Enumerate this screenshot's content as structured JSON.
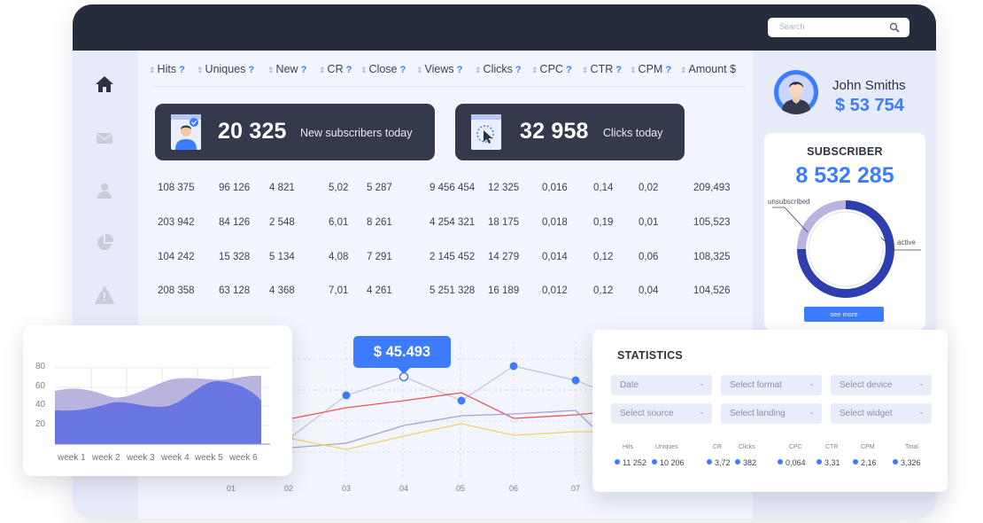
{
  "search": {
    "placeholder": "Search"
  },
  "table": {
    "columns": [
      "Hits",
      "Uniques",
      "New",
      "CR",
      "Close",
      "Views",
      "Clicks",
      "CPC",
      "CTR",
      "CPM",
      "Amount $"
    ],
    "rows": [
      [
        "108 375",
        "96 126",
        "4 821",
        "5,02",
        "5 287",
        "9 456 454",
        "12 325",
        "0,016",
        "0,14",
        "0,02",
        "209,493"
      ],
      [
        "203 942",
        "84 126",
        "2 548",
        "6,01",
        "8 261",
        "4 254 321",
        "18 175",
        "0,018",
        "0,19",
        "0,01",
        "105,523"
      ],
      [
        "104 242",
        "15 328",
        "5 134",
        "4,08",
        "7 291",
        "2 145 452",
        "14 279",
        "0,014",
        "0,12",
        "0,06",
        "108,325"
      ],
      [
        "208 358",
        "63 128",
        "4 368",
        "7,01",
        "4 261",
        "5 251 328",
        "16 189",
        "0,012",
        "0,12",
        "0,04",
        "104,526"
      ]
    ]
  },
  "cards": [
    {
      "value": "20 325",
      "label": "New subscribers today"
    },
    {
      "value": "32 958",
      "label": "Clicks today"
    }
  ],
  "profile": {
    "name": "John Smiths",
    "balance": "$ 53 754"
  },
  "subscriber": {
    "title": "SUBSCRIBER",
    "count": "8 532 285",
    "unsubscribed_label": "unsubscribed",
    "active_label": "active",
    "see_more": "see more"
  },
  "line_chart": {
    "tooltip": "$ 45.493",
    "x_labels": [
      "01",
      "02",
      "03",
      "04",
      "05",
      "06",
      "07"
    ]
  },
  "area_chart": {
    "y_labels": [
      "80",
      "60",
      "40",
      "20"
    ],
    "x_labels": [
      "week 1",
      "week 2",
      "week 3",
      "week 4",
      "week 5",
      "week 6"
    ]
  },
  "statistics": {
    "title": "STATISTICS",
    "selects": [
      "Date",
      "Select format",
      "Select device",
      "Select source",
      "Select landing",
      "Select widget"
    ],
    "headers": [
      "Hits",
      "Uniques",
      "CR",
      "Clicks",
      "CPC",
      "CTR",
      "CPM",
      "Total"
    ],
    "values": [
      "11 252",
      "10 206",
      "3,72",
      "382",
      "0,064",
      "3,31",
      "2,16",
      "3,326"
    ]
  },
  "colors": {
    "accent": "#3d7bff",
    "dark": "#252d3d",
    "card": "#343a4b",
    "line_red": "#e3565e",
    "line_yellow": "#f5d06a",
    "line_purple": "#a5a3d8"
  }
}
